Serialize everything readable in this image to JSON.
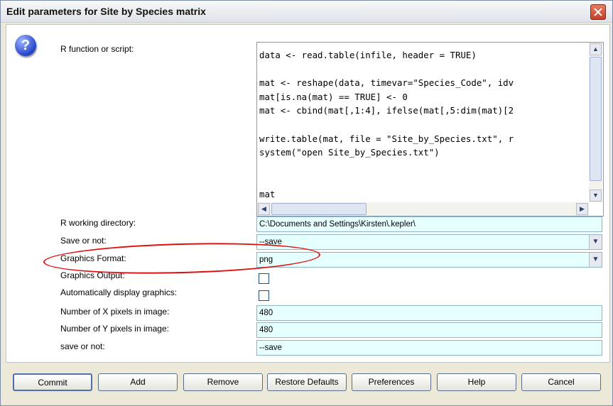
{
  "window": {
    "title": "Edit parameters for Site by Species matrix"
  },
  "params": {
    "r_function_label": "R function or script:",
    "script_lines": [
      "data <- read.table(infile, header = TRUE)",
      "",
      "mat <- reshape(data, timevar=\"Species_Code\", idv",
      "mat[is.na(mat) == TRUE] <- 0",
      "mat <- cbind(mat[,1:4], ifelse(mat[,5:dim(mat)[2",
      "",
      "write.table(mat, file = \"Site_by_Species.txt\", r",
      "system(\"open Site_by_Species.txt\")",
      "",
      "",
      "mat"
    ],
    "working_dir_label": "R working directory:",
    "working_dir_value": "C:\\Documents and Settings\\Kirsten\\.kepler\\",
    "save_label": "Save or not:",
    "save_value": "--save",
    "graphics_format_label": "Graphics Format:",
    "graphics_format_value": "png",
    "graphics_output_label": "Graphics Output:",
    "auto_display_label": "Automatically display graphics:",
    "x_pixels_label": "Number of X pixels in image:",
    "x_pixels_value": "480",
    "y_pixels_label": "Number of Y pixels in image:",
    "y_pixels_value": "480",
    "save2_label": "save or not:",
    "save2_value": "--save"
  },
  "buttons": {
    "commit": "Commit",
    "add": "Add",
    "remove": "Remove",
    "restore": "Restore Defaults",
    "preferences": "Preferences",
    "help": "Help",
    "cancel": "Cancel"
  },
  "colors": {
    "field_bg": "#e6ffff",
    "highlight": "#e01010"
  }
}
